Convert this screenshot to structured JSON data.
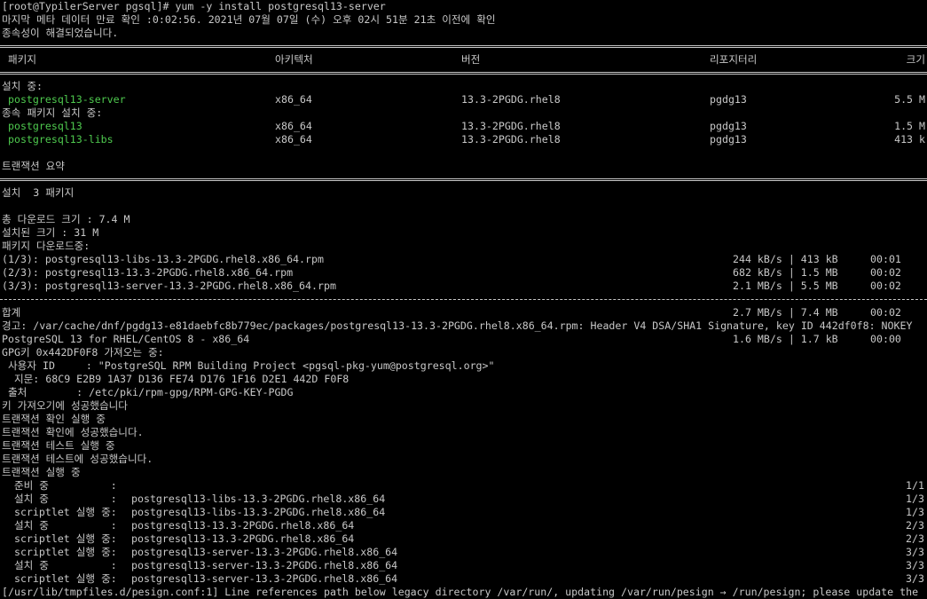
{
  "terminal": {
    "lines": [
      {
        "type": "text",
        "text": "[root@TypilerServer pgsql]# yum -y install postgresql13-server"
      },
      {
        "type": "text",
        "text": "마지막 메타 데이터 만료 확인 :0:02:56. 2021년 07월 07일 (수) 오후 02시 51분 21초 이전에 확인"
      },
      {
        "type": "text",
        "text": "종속성이 해결되었습니다."
      },
      {
        "type": "rule"
      },
      {
        "type": "row",
        "cols": [
          " 패키지",
          "아키텍처",
          "버전",
          "리포지터리",
          "크기"
        ]
      },
      {
        "type": "rule"
      },
      {
        "type": "text",
        "text": "설치 중:"
      },
      {
        "type": "row",
        "green": true,
        "cols": [
          " postgresql13-server",
          "x86_64",
          "13.3-2PGDG.rhel8",
          "pgdg13",
          "5.5 M"
        ]
      },
      {
        "type": "text",
        "text": "종속 패키지 설치 중:"
      },
      {
        "type": "row",
        "green": true,
        "cols": [
          " postgresql13",
          "x86_64",
          "13.3-2PGDG.rhel8",
          "pgdg13",
          "1.5 M"
        ]
      },
      {
        "type": "row",
        "green": true,
        "cols": [
          " postgresql13-libs",
          "x86_64",
          "13.3-2PGDG.rhel8",
          "pgdg13",
          "413 k"
        ]
      },
      {
        "type": "text",
        "text": ""
      },
      {
        "type": "text",
        "text": "트랜잭션 요약"
      },
      {
        "type": "rule"
      },
      {
        "type": "text",
        "text": "설치  3 패키지"
      },
      {
        "type": "text",
        "text": ""
      },
      {
        "type": "text",
        "text": "총 다운로드 크기 : 7.4 M"
      },
      {
        "type": "text",
        "text": "설치된 크기 : 31 M"
      },
      {
        "type": "text",
        "text": "패키지 다운로드중:"
      },
      {
        "type": "dl",
        "cols": [
          "(1/3): postgresql13-libs-13.3-2PGDG.rhel8.x86_64.rpm",
          "244 kB/s | 413 kB",
          "00:01"
        ]
      },
      {
        "type": "dl",
        "cols": [
          "(2/3): postgresql13-13.3-2PGDG.rhel8.x86_64.rpm",
          "682 kB/s | 1.5 MB",
          "00:02"
        ]
      },
      {
        "type": "dl",
        "cols": [
          "(3/3): postgresql13-server-13.3-2PGDG.rhel8.x86_64.rpm",
          "2.1 MB/s | 5.5 MB",
          "00:02"
        ]
      },
      {
        "type": "dashrule"
      },
      {
        "type": "dl",
        "cols": [
          "합계",
          "2.7 MB/s | 7.4 MB",
          "00:02"
        ]
      },
      {
        "type": "text",
        "text": "경고: /var/cache/dnf/pgdg13-e81daebfc8b779ec/packages/postgresql13-13.3-2PGDG.rhel8.x86_64.rpm: Header V4 DSA/SHA1 Signature, key ID 442df0f8: NOKEY"
      },
      {
        "type": "dl",
        "cols": [
          "PostgreSQL 13 for RHEL/CentOS 8 - x86_64",
          "1.6 MB/s | 1.7 kB",
          "00:00"
        ]
      },
      {
        "type": "text",
        "text": "GPG키 0x442DF0F8 가져오는 중:"
      },
      {
        "type": "text",
        "text": " 사용자 ID     : \"PostgreSQL RPM Building Project <pgsql-pkg-yum@postgresql.org>\""
      },
      {
        "type": "text",
        "text": "  지문: 68C9 E2B9 1A37 D136 FE74 D176 1F16 D2E1 442D F0F8"
      },
      {
        "type": "text",
        "text": " 출처        : /etc/pki/rpm-gpg/RPM-GPG-KEY-PGDG"
      },
      {
        "type": "text",
        "text": "키 가져오기에 성공했습니다"
      },
      {
        "type": "text",
        "text": "트랜잭션 확인 실행 중"
      },
      {
        "type": "text",
        "text": "트랜잭션 확인에 성공했습니다."
      },
      {
        "type": "text",
        "text": "트랜잭션 테스트 실행 중"
      },
      {
        "type": "text",
        "text": "트랜잭션 테스트에 성공했습니다."
      },
      {
        "type": "text",
        "text": "트랜잭션 실행 중"
      },
      {
        "type": "step",
        "cols": [
          "  준비 중          :",
          "",
          "1/1"
        ]
      },
      {
        "type": "step",
        "cols": [
          "  설치 중          : ",
          "postgresql13-libs-13.3-2PGDG.rhel8.x86_64",
          "1/3"
        ]
      },
      {
        "type": "step",
        "cols": [
          "  scriptlet 실행 중: ",
          "postgresql13-libs-13.3-2PGDG.rhel8.x86_64",
          "1/3"
        ]
      },
      {
        "type": "step",
        "cols": [
          "  설치 중          : ",
          "postgresql13-13.3-2PGDG.rhel8.x86_64",
          "2/3"
        ]
      },
      {
        "type": "step",
        "cols": [
          "  scriptlet 실행 중: ",
          "postgresql13-13.3-2PGDG.rhel8.x86_64",
          "2/3"
        ]
      },
      {
        "type": "step",
        "cols": [
          "  scriptlet 실행 중: ",
          "postgresql13-server-13.3-2PGDG.rhel8.x86_64",
          "3/3"
        ]
      },
      {
        "type": "step",
        "cols": [
          "  설치 중          : ",
          "postgresql13-server-13.3-2PGDG.rhel8.x86_64",
          "3/3"
        ]
      },
      {
        "type": "step",
        "cols": [
          "  scriptlet 실행 중: ",
          "postgresql13-server-13.3-2PGDG.rhel8.x86_64",
          "3/3"
        ]
      },
      {
        "type": "text",
        "text": "[/usr/lib/tmpfiles.d/pesign.conf:1] Line references path below legacy directory /var/run/, updating /var/run/pesign → /run/pesign; please update the"
      }
    ]
  }
}
